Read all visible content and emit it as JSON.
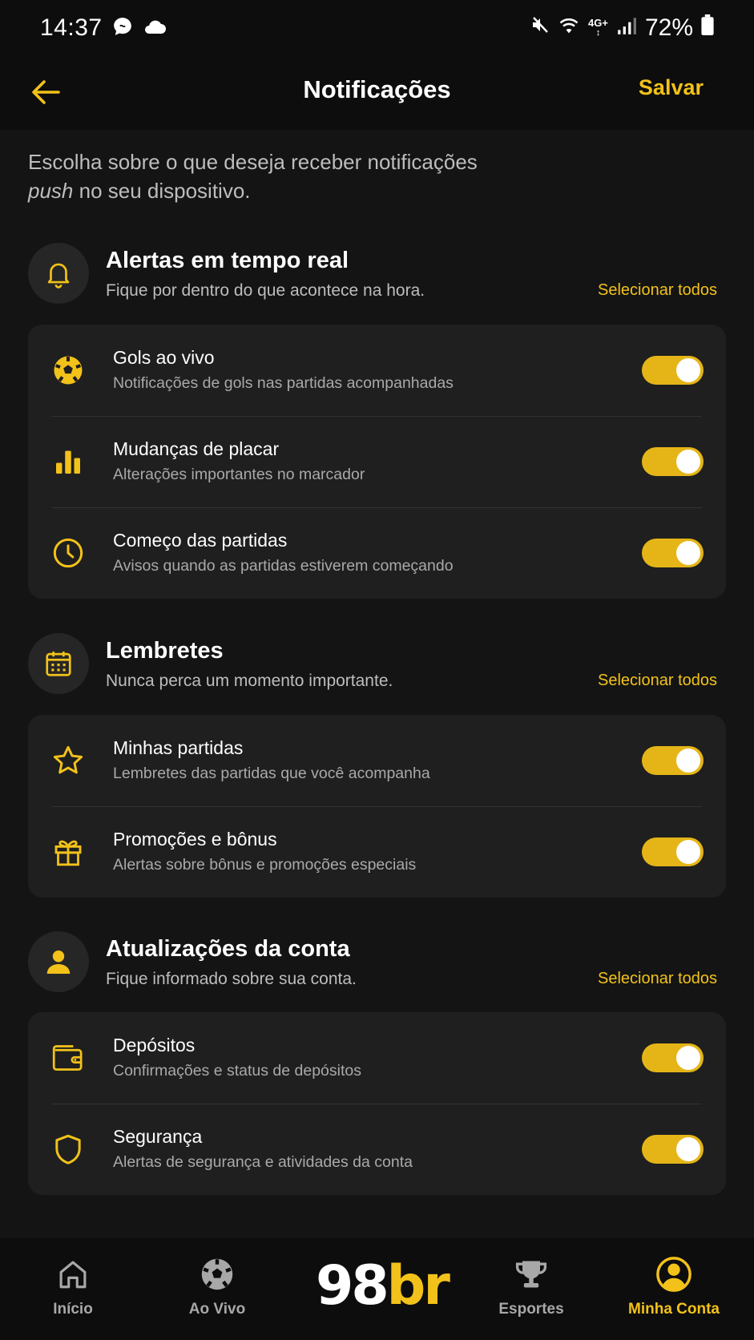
{
  "status_bar": {
    "time": "14:37",
    "battery": "72%",
    "network": "4G+"
  },
  "header": {
    "title": "Notificações",
    "save_label": "Salvar",
    "back_icon": "arrow-left-icon"
  },
  "intro": {
    "emphasis": "push",
    "line1": "Escolha sobre o que deseja receber notificações",
    "line2_rest": " no seu dispositivo."
  },
  "sections": [
    {
      "title": "Alertas em tempo real",
      "subtitle": "Fique por dentro do que acontece na hora.",
      "select_all": "Selecionar todos",
      "icon": "bell-icon",
      "items": [
        {
          "title": "Gols ao vivo",
          "subtitle": "Notificações de gols nas partidas acompanhadas",
          "icon": "soccer-ball-icon",
          "enabled": true
        },
        {
          "title": "Mudanças de placar",
          "subtitle": "Alterações importantes no marcador",
          "icon": "bar-chart-icon",
          "enabled": true
        },
        {
          "title": "Começo das partidas",
          "subtitle": "Avisos quando as partidas estiverem começando",
          "icon": "clock-icon",
          "enabled": true
        }
      ]
    },
    {
      "title": "Lembretes",
      "subtitle": "Nunca perca um momento importante.",
      "select_all": "Selecionar todos",
      "icon": "calendar-icon",
      "items": [
        {
          "title": "Minhas partidas",
          "subtitle": "Lembretes das partidas que você acompanha",
          "icon": "star-icon",
          "enabled": true
        },
        {
          "title": "Promoções e bônus",
          "subtitle": "Alertas sobre bônus e promoções especiais",
          "icon": "gift-icon",
          "enabled": true
        }
      ]
    },
    {
      "title": "Atualizações da conta",
      "subtitle": "Fique informado sobre sua conta.",
      "select_all": "Selecionar todos",
      "icon": "user-icon",
      "items": [
        {
          "title": "Depósitos",
          "subtitle": "Confirmações e status de depósitos",
          "icon": "wallet-icon",
          "enabled": true
        },
        {
          "title": "Segurança",
          "subtitle": "Alertas de segurança e atividades da conta",
          "icon": "shield-icon",
          "enabled": true
        }
      ]
    }
  ],
  "bottom_nav": {
    "brand_part1": "98",
    "brand_part2": "br",
    "items": [
      {
        "label": "Início",
        "icon": "home-icon"
      },
      {
        "label": "Ao Vivo",
        "icon": "soccer-ball-icon"
      },
      {
        "label": "Esportes",
        "icon": "trophy-icon"
      },
      {
        "label": "Minha Conta",
        "icon": "user-circle-icon",
        "active": true
      }
    ]
  },
  "colors": {
    "accent": "#f2c21a",
    "background": "#141414",
    "card": "#1f1f1f",
    "toggle_on": "#e5b518"
  }
}
